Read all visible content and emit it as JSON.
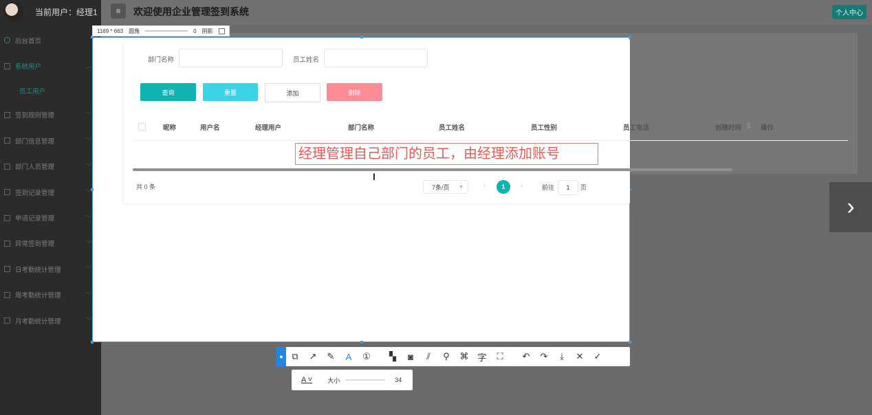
{
  "header": {
    "user_label": "当前用户：经理1",
    "title": "欢迎使用企业管理签到系统",
    "personal_center": "个人中心",
    "menu_glyph": "≡"
  },
  "sidebar": {
    "items": [
      {
        "label": "后台首页",
        "icon": "home-icon"
      },
      {
        "label": "系统用户",
        "icon": "edit-icon",
        "active": true
      },
      {
        "label": "签到规则管理",
        "icon": "edit-icon"
      },
      {
        "label": "部门信息管理",
        "icon": "edit-icon"
      },
      {
        "label": "部门人员管理",
        "icon": "edit-icon"
      },
      {
        "label": "签到记录管理",
        "icon": "edit-icon"
      },
      {
        "label": "申请记录管理",
        "icon": "edit-icon"
      },
      {
        "label": "异常签到管理",
        "icon": "edit-icon"
      },
      {
        "label": "日考勤统计管理",
        "icon": "edit-icon"
      },
      {
        "label": "周考勤统计管理",
        "icon": "edit-icon"
      },
      {
        "label": "月考勤统计管理",
        "icon": "edit-icon"
      }
    ],
    "sub_item": "员工用户"
  },
  "capture": {
    "dims": "1169 * 663",
    "radius_label": "圆角",
    "radius_value": "0",
    "shadow_label": "阴影"
  },
  "search": {
    "dept_label": "部门名称",
    "dept_value": "",
    "name_label": "员工姓名",
    "name_value": ""
  },
  "buttons": {
    "query": "查询",
    "reset": "重置",
    "add": "添加",
    "delete": "删除"
  },
  "table": {
    "columns": [
      "昵称",
      "用户名",
      "经理用户",
      "部门名称",
      "员工姓名",
      "员工性别",
      "员工电话",
      "创建时间",
      "操作"
    ],
    "sort_glyph": "⇕"
  },
  "annotation_text": "经理管理自己部门的员工，由经理添加账号",
  "pagination": {
    "total": "共 0 条",
    "page_size": "7条/页",
    "current_page": "1",
    "goto_label": "前往",
    "goto_value": "1",
    "page_suffix": "页"
  },
  "toolbar": {
    "size_label": "大小",
    "size_value": "34",
    "tools": [
      "shape-icon",
      "arrow-icon",
      "pen-icon",
      "text-icon",
      "number-icon",
      "mosaic-icon",
      "blur-icon",
      "stripe-icon",
      "pin-icon",
      "ocr-icon",
      "translate-icon",
      "scan-icon",
      "undo-icon",
      "redo-icon",
      "download-icon",
      "close-icon",
      "check-icon"
    ]
  },
  "colors": {
    "teal": "#0fb4b0",
    "cyan": "#3bd3e6",
    "pink": "#ff8b96",
    "annotation_red": "#e05a5a",
    "selection_blue": "#1e88e5"
  }
}
